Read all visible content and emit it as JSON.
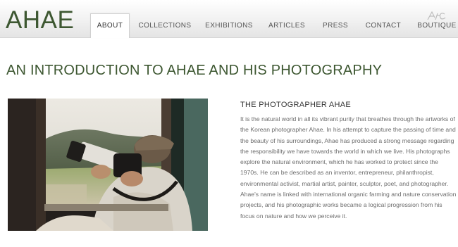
{
  "brand": {
    "logo_text": "AHAE"
  },
  "nav": {
    "items": [
      {
        "label": "ABOUT"
      },
      {
        "label": "COLLECTIONS"
      },
      {
        "label": "EXHIBITIONS"
      },
      {
        "label": "ARTICLES"
      },
      {
        "label": "PRESS"
      },
      {
        "label": "CONTACT"
      },
      {
        "label": "BOUTIQUE"
      }
    ],
    "active": "ABOUT"
  },
  "main": {
    "title": "AN INTRODUCTION TO AHAE AND HIS PHOTOGRAPHY",
    "section_heading": "THE PHOTOGRAPHER AHAE",
    "body": "It is the natural world in all its vibrant purity that breathes through the artworks of the Korean photographer Ahae. In his attempt to capture the passing of time and the beauty of his surroundings, Ahae has produced a strong message regarding the responsibility we have towards the world in which we live. His photographs explore the natural environment, which he has worked to protect since the 1970s. He can be described as an inventor, entrepreneur, philanthropist, environmental activist, martial artist, painter, sculptor, poet, and photographer. Ahae's name is linked with international organic farming and nature conservation projects, and his photographic works became a logical progression from his focus on nature and how we perceive it."
  },
  "colors": {
    "brand_green": "#3d5731",
    "body_text": "#6c6c6c",
    "header_bg": "#f1f1f1"
  }
}
